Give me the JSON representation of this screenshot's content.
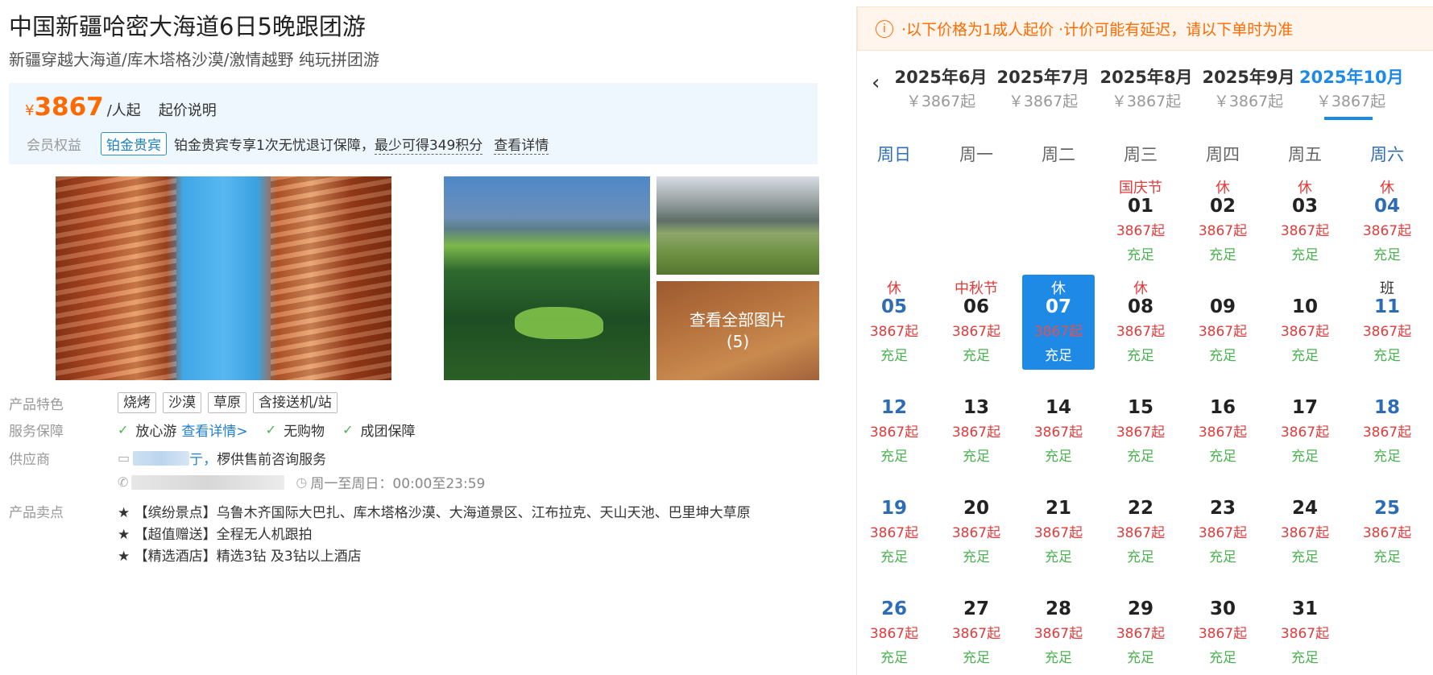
{
  "product": {
    "title": "中国新疆哈密大海道6日5晚跟团游",
    "subtitle": "新疆穿越大海道/库木塔格沙漠/激情越野 纯玩拼团游"
  },
  "price": {
    "currency": "¥",
    "amount": "3867",
    "unit": "/人起",
    "explain_label": "起价说明"
  },
  "member": {
    "label": "会员权益",
    "badge": "铂金贵宾",
    "text": "铂金贵宾专享1次无忧退订保障，",
    "points": "最少可得349积分",
    "detail_link": "查看详情"
  },
  "gallery": {
    "view_all_label": "查看全部图片",
    "count_label": "(5)"
  },
  "features": {
    "label": "产品特色",
    "tags": [
      "烧烤",
      "沙漠",
      "草原",
      "含接送机/站"
    ]
  },
  "service": {
    "label": "服务保障",
    "items": [
      "放心游",
      "无购物",
      "成团保障"
    ],
    "detail_link": "查看详情>"
  },
  "supplier": {
    "label": "供应商",
    "name_suffix": "亍，",
    "desc": "椤供售前咨询服务",
    "hours": "周一至周日：00:00至23:59"
  },
  "selling_points": {
    "label": "产品卖点",
    "items": [
      "★ 【缤纷景点】乌鲁木齐国际大巴扎、库木塔格沙漠、大海道景区、江布拉克、天山天池、巴里坤大草原",
      "★ 【超值赠送】全程无人机跟拍",
      "★ 【精选酒店】精选3钻 及3钻以上酒店"
    ]
  },
  "calendar": {
    "notice": "·以下价格为1成人起价 ·计价可能有延迟，请以下单时为准",
    "prev_icon": "chevron-left-icon",
    "months": [
      {
        "name": "2025年6月",
        "price": "￥3867起"
      },
      {
        "name": "2025年7月",
        "price": "￥3867起"
      },
      {
        "name": "2025年8月",
        "price": "￥3867起"
      },
      {
        "name": "2025年9月",
        "price": "￥3867起"
      },
      {
        "name": "2025年10月",
        "price": "￥3867起"
      }
    ],
    "active_month_index": 4,
    "weekdays": [
      "周日",
      "周一",
      "周二",
      "周三",
      "周四",
      "周五",
      "周六"
    ],
    "first_weekday_index": 3,
    "selected_day": "07",
    "days": [
      {
        "day": "01",
        "top": "国庆节",
        "price": "3867起",
        "stock": "充足"
      },
      {
        "day": "02",
        "top": "休",
        "price": "3867起",
        "stock": "充足"
      },
      {
        "day": "03",
        "top": "休",
        "price": "3867起",
        "stock": "充足"
      },
      {
        "day": "04",
        "top": "休",
        "price": "3867起",
        "stock": "充足"
      },
      {
        "day": "05",
        "top": "休",
        "price": "3867起",
        "stock": "充足"
      },
      {
        "day": "06",
        "top": "中秋节",
        "price": "3867起",
        "stock": "充足"
      },
      {
        "day": "07",
        "top": "休",
        "price": "3867起",
        "stock": "充足"
      },
      {
        "day": "08",
        "top": "休",
        "price": "3867起",
        "stock": "充足"
      },
      {
        "day": "09",
        "top": "",
        "price": "3867起",
        "stock": "充足"
      },
      {
        "day": "10",
        "top": "",
        "price": "3867起",
        "stock": "充足"
      },
      {
        "day": "11",
        "top": "班",
        "price": "3867起",
        "stock": "充足"
      },
      {
        "day": "12",
        "top": "",
        "price": "3867起",
        "stock": "充足"
      },
      {
        "day": "13",
        "top": "",
        "price": "3867起",
        "stock": "充足"
      },
      {
        "day": "14",
        "top": "",
        "price": "3867起",
        "stock": "充足"
      },
      {
        "day": "15",
        "top": "",
        "price": "3867起",
        "stock": "充足"
      },
      {
        "day": "16",
        "top": "",
        "price": "3867起",
        "stock": "充足"
      },
      {
        "day": "17",
        "top": "",
        "price": "3867起",
        "stock": "充足"
      },
      {
        "day": "18",
        "top": "",
        "price": "3867起",
        "stock": "充足"
      },
      {
        "day": "19",
        "top": "",
        "price": "3867起",
        "stock": "充足"
      },
      {
        "day": "20",
        "top": "",
        "price": "3867起",
        "stock": "充足"
      },
      {
        "day": "21",
        "top": "",
        "price": "3867起",
        "stock": "充足"
      },
      {
        "day": "22",
        "top": "",
        "price": "3867起",
        "stock": "充足"
      },
      {
        "day": "23",
        "top": "",
        "price": "3867起",
        "stock": "充足"
      },
      {
        "day": "24",
        "top": "",
        "price": "3867起",
        "stock": "充足"
      },
      {
        "day": "25",
        "top": "",
        "price": "3867起",
        "stock": "充足"
      },
      {
        "day": "26",
        "top": "",
        "price": "3867起",
        "stock": "充足"
      },
      {
        "day": "27",
        "top": "",
        "price": "3867起",
        "stock": "充足"
      },
      {
        "day": "28",
        "top": "",
        "price": "3867起",
        "stock": "充足"
      },
      {
        "day": "29",
        "top": "",
        "price": "3867起",
        "stock": "充足"
      },
      {
        "day": "30",
        "top": "",
        "price": "3867起",
        "stock": "充足"
      },
      {
        "day": "31",
        "top": "",
        "price": "3867起",
        "stock": "充足"
      }
    ]
  }
}
